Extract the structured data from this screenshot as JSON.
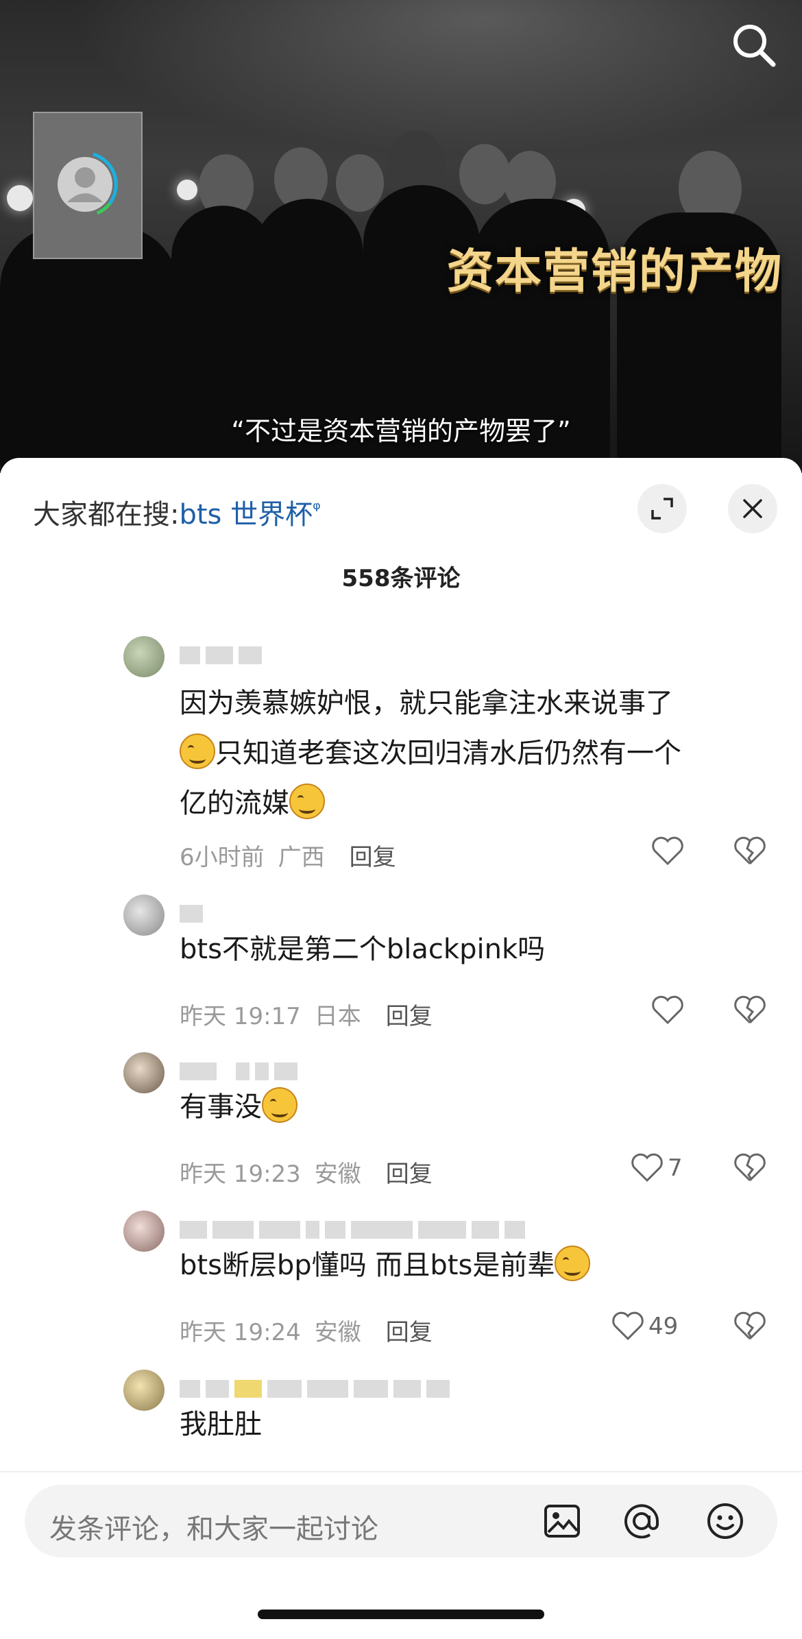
{
  "video": {
    "title_overlay": "资本营销的产物",
    "subtitle": "“不过是资本营销的产物罢了”",
    "search_icon": "search-icon",
    "avatar_icon": "user-avatar-icon"
  },
  "sheet": {
    "hot_search_prefix": "大家都在搜:",
    "hot_search_keyword": "bts 世界杯",
    "hot_search_icon": "ᵠ",
    "expand_icon": "expand-icon",
    "close_icon": "close-icon",
    "comment_count": "558条评论"
  },
  "comments": [
    {
      "lines": [
        "因为羡慕嫉妒恨，就只能拿注水来说事了",
        "只知道老套这次回归清水后仍然有一个",
        "亿的流媒"
      ],
      "time": "6小时前",
      "location": "广西",
      "reply": "回复",
      "likes": ""
    },
    {
      "lines": [
        "bts不就是第二个blackpink吗"
      ],
      "time": "昨天 19:17",
      "location": "日本",
      "reply": "回复",
      "likes": ""
    },
    {
      "lines": [
        "有事没"
      ],
      "time": "昨天 19:23",
      "location": "安徽",
      "reply": "回复",
      "likes": "7"
    },
    {
      "lines": [
        "bts断层bp懂吗 而且bts是前辈"
      ],
      "time": "昨天 19:24",
      "location": "安徽",
      "reply": "回复",
      "likes": "49"
    },
    {
      "lines": [
        "我肚肚"
      ],
      "time": "",
      "location": "",
      "reply": "",
      "likes": ""
    }
  ],
  "input": {
    "placeholder": "发条评论，和大家一起讨论",
    "image_icon": "image-icon",
    "mention_icon": "at-mention-icon",
    "emoji_icon": "emoji-icon"
  },
  "colors": {
    "keyword": "#1f5fa8",
    "title_overlay": "#f4d58c",
    "meta_text": "#9a9a9a"
  }
}
